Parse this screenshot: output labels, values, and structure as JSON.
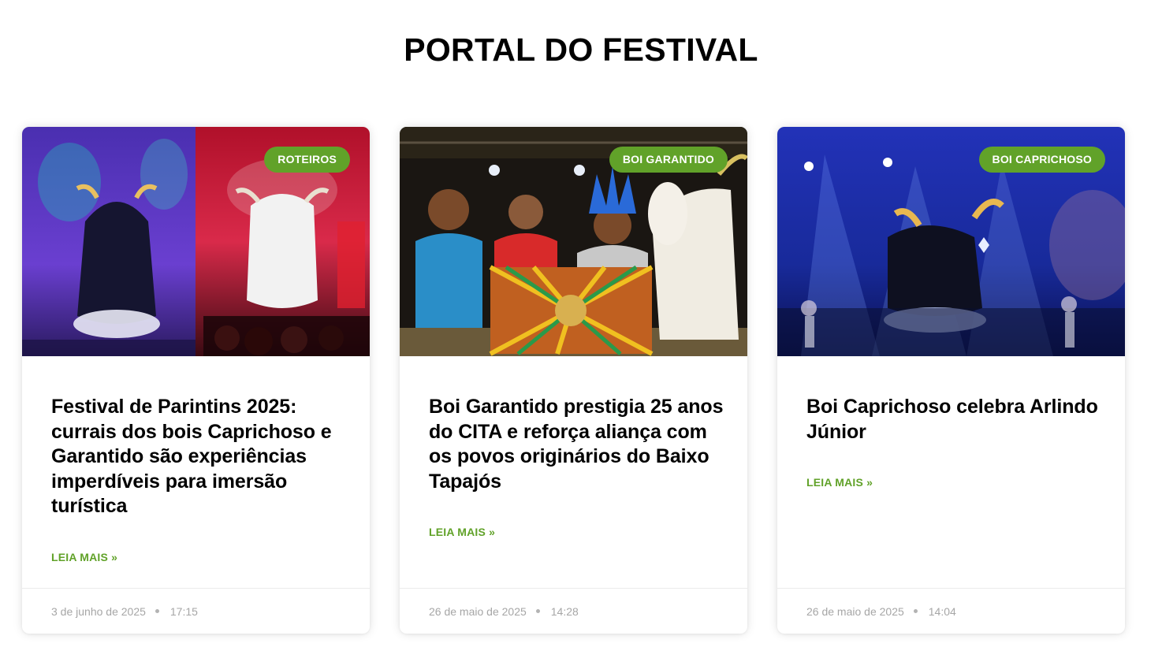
{
  "section": {
    "title": "PORTAL DO FESTIVAL"
  },
  "posts": [
    {
      "category": "ROTEIROS",
      "title": "Festival de Parintins 2025: currais dos bois Caprichoso e Garantido são experiências imperdíveis para imersão turística",
      "read_more": "LEIA MAIS »",
      "date": "3 de junho de 2025",
      "time": "17:15",
      "image_icon": "festival-stage-photo"
    },
    {
      "category": "BOI GARANTIDO",
      "title": "Boi Garantido prestigia 25 anos do CITA e reforça aliança com os povos originários do Baixo Tapajós",
      "read_more": "LEIA MAIS »",
      "date": "26 de maio de 2025",
      "time": "14:28",
      "image_icon": "ceremony-photo"
    },
    {
      "category": "BOI CAPRICHOSO",
      "title": "Boi Caprichoso celebra Arlindo Júnior",
      "read_more": "LEIA MAIS »",
      "date": "26 de maio de 2025",
      "time": "14:04",
      "image_icon": "boi-caprichoso-stage-photo"
    }
  ],
  "colors": {
    "accent": "#61a229",
    "meta_text": "#a6a6a6",
    "title_text": "#000000"
  }
}
